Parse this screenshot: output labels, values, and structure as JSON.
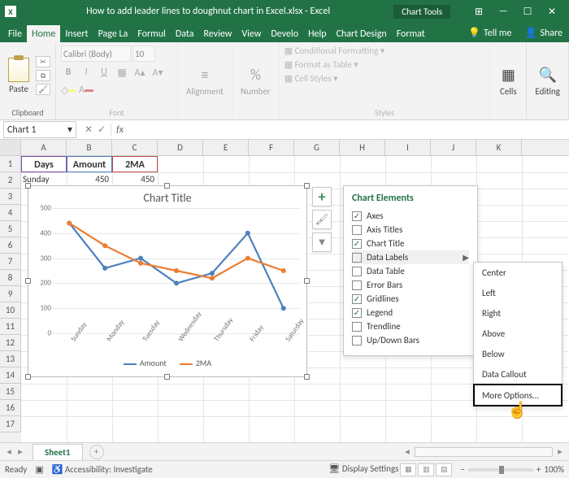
{
  "titlebar": {
    "app_icon": "X",
    "filename": "How to add leader lines to doughnut chart in Excel.xlsx",
    "app": "Excel",
    "context_tab": "Chart Tools"
  },
  "win_buttons": {
    "account": "⊞",
    "min": "—",
    "max": "☐",
    "close": "✕"
  },
  "tabs": {
    "file": "File",
    "home": "Home",
    "insert": "Insert",
    "page": "Page La",
    "formul": "Formul",
    "data": "Data",
    "review": "Review",
    "view": "View",
    "develop": "Develo",
    "help": "Help",
    "cdesign": "Chart Design",
    "format": "Format",
    "tellme": "Tell me",
    "share": "Share"
  },
  "ribbon": {
    "clipboard": {
      "paste": "Paste",
      "label": "Clipboard"
    },
    "font": {
      "name": "Calibri (Body)",
      "size": "10",
      "label": "Font"
    },
    "alignment": {
      "btn": "Alignment",
      "label": "Alignment"
    },
    "number": {
      "btn": "Number",
      "label": "Number"
    },
    "styles": {
      "cond": "Conditional Formatting",
      "table": "Format as Table",
      "cell": "Cell Styles",
      "label": "Styles"
    },
    "cells": {
      "btn": "Cells"
    },
    "editing": {
      "btn": "Editing"
    }
  },
  "namebox": "Chart 1",
  "columns": [
    "A",
    "B",
    "C",
    "D",
    "E",
    "F",
    "G",
    "H",
    "I",
    "J",
    "K"
  ],
  "rows": [
    "1",
    "2",
    "3",
    "4",
    "5",
    "6",
    "7",
    "8",
    "9",
    "10",
    "11",
    "12",
    "13",
    "14",
    "15",
    "16",
    "17"
  ],
  "table": {
    "h1": "Days",
    "h2": "Amount",
    "h3": "2MA",
    "r2c1": "Sunday",
    "r2c2": "450",
    "r2c3": "450"
  },
  "chart_data": {
    "type": "line",
    "title": "Chart Title",
    "categories": [
      "Sunday",
      "Monday",
      "Tuesday",
      "Wednesday",
      "Thursday",
      "Friday",
      "Saturday"
    ],
    "series": [
      {
        "name": "Amount",
        "color": "#4e81bd",
        "values": [
          440,
          260,
          300,
          200,
          240,
          400,
          100
        ]
      },
      {
        "name": "2MA",
        "color": "#ed7d31",
        "values": [
          440,
          350,
          280,
          250,
          220,
          300,
          250
        ]
      }
    ],
    "ylim": [
      0,
      500
    ],
    "yticks": [
      0,
      100,
      200,
      300,
      400,
      500
    ],
    "legend_position": "bottom",
    "gridlines": true
  },
  "side_buttons": {
    "plus": "+",
    "brush": "🖌",
    "funnel": "▼"
  },
  "flyout": {
    "title": "Chart Elements",
    "items": [
      {
        "label": "Axes",
        "checked": true
      },
      {
        "label": "Axis Titles",
        "checked": false
      },
      {
        "label": "Chart Title",
        "checked": true
      },
      {
        "label": "Data Labels",
        "checked": false,
        "submenu": true
      },
      {
        "label": "Data Table",
        "checked": false
      },
      {
        "label": "Error Bars",
        "checked": false
      },
      {
        "label": "Gridlines",
        "checked": true
      },
      {
        "label": "Legend",
        "checked": true
      },
      {
        "label": "Trendline",
        "checked": false
      },
      {
        "label": "Up/Down Bars",
        "checked": false
      }
    ]
  },
  "submenu": {
    "items": [
      "Center",
      "Left",
      "Right",
      "Above",
      "Below",
      "Data Callout",
      "More Options..."
    ]
  },
  "sheet": {
    "name": "Sheet1"
  },
  "status": {
    "ready": "Ready",
    "access": "Accessibility: Investigate",
    "display": "Display Settings",
    "zoom": "100%"
  }
}
